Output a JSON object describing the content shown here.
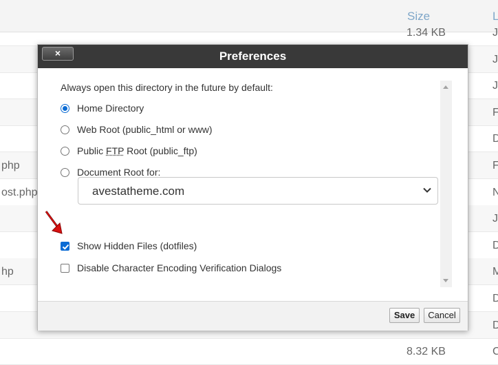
{
  "background": {
    "columns": {
      "size": "Size",
      "last": "L"
    },
    "rows": [
      {
        "name": "",
        "size": "1.34 KB",
        "last": "J"
      },
      {
        "name": "",
        "size": "",
        "last": "J"
      },
      {
        "name": "",
        "size": "",
        "last": "J"
      },
      {
        "name": "",
        "size": "",
        "last": "F"
      },
      {
        "name": "",
        "size": "",
        "last": "D"
      },
      {
        "name": "php",
        "size": "",
        "last": "F"
      },
      {
        "name": "ost.php",
        "size": "",
        "last": "N"
      },
      {
        "name": "",
        "size": "",
        "last": "J"
      },
      {
        "name": "",
        "size": "",
        "last": "D"
      },
      {
        "name": "hp",
        "size": "",
        "last": "M"
      },
      {
        "name": "",
        "size": "",
        "last": "D"
      },
      {
        "name": "",
        "size": "",
        "last": "D"
      },
      {
        "name": "",
        "size": "8.32 KB",
        "last": "C"
      }
    ]
  },
  "dialog": {
    "title": "Preferences",
    "close_label": "×",
    "intro": "Always open this directory in the future by default:",
    "radios": [
      {
        "label": "Home Directory",
        "checked": true
      },
      {
        "label": "Web Root (public_html or www)",
        "checked": false
      },
      {
        "label_pre": "Public ",
        "label_abbr": "FTP",
        "label_post": " Root (public_ftp)",
        "checked": false
      },
      {
        "label": "Document Root for:",
        "checked": false
      }
    ],
    "document_root_select": {
      "value": "avestatheme.com"
    },
    "checkboxes": [
      {
        "label": "Show Hidden Files (dotfiles)",
        "checked": true
      },
      {
        "label": "Disable Character Encoding Verification Dialogs",
        "checked": false
      }
    ],
    "save_label": "Save",
    "cancel_label": "Cancel"
  },
  "colors": {
    "accent": "#0b6bd4",
    "titlebar": "#393939",
    "arrow": "#d81010"
  }
}
